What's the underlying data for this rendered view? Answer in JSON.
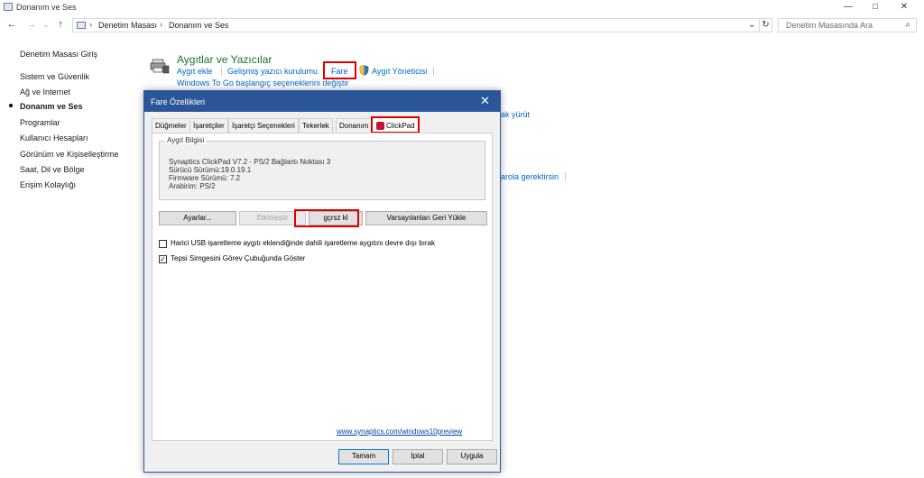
{
  "window": {
    "title": "Donanım ve Ses",
    "min": "—",
    "max": "□",
    "close": "✕"
  },
  "address": {
    "back": "←",
    "forward": "→",
    "recent": "⌄",
    "up": "↑",
    "crumbs": [
      "Denetim Masası",
      "Donanım ve Ses"
    ],
    "sep": "›",
    "dropdown": "⌄",
    "refresh": "↻",
    "search_placeholder": "Denetim Masasında Ara",
    "search_icon": "⌕"
  },
  "sidebar": {
    "items": [
      "Denetim Masası Giriş",
      "Sistem ve Güvenlik",
      "Ağ ve Internet",
      "Donanım ve Ses",
      "Programlar",
      "Kullanıcı Hesapları",
      "Görünüm ve Kişiselleştirme",
      "Saat, Dil ve Bölge",
      "Erişim Kolaylığı"
    ]
  },
  "main": {
    "section_title": "Aygıtlar ve Yazıcılar",
    "links": [
      "Aygıt ekle",
      "Gelişmiş yazıcı kurulumu",
      "Fare",
      "Aygıt Yöneticisi"
    ],
    "link2": "Windows To Go başlangıç seçeneklerini değiştir",
    "partial1": "ak yürüt",
    "partial2": "arola gerektirsin"
  },
  "dialog": {
    "title": "Fare Özellikleri",
    "close": "✕",
    "tabs": [
      "Düğmeler",
      "İşaretçiler",
      "İşaretçi Seçenekleri",
      "Tekerlek",
      "Donanım",
      "ClickPad"
    ],
    "active_tab": "ClickPad",
    "group_label": "Aygıt Bilgisi",
    "info": [
      "Synaptics ClickPad V7.2 - PS/2 Bağlantı Noktası 3",
      "Sürücü Sürümü:19.0.19.1",
      "Firmware Sürümü: 7.2",
      "Arabirim: PS/2"
    ],
    "buttons": {
      "settings": "Ayarlar...",
      "enable": "Etkinleştir",
      "disable": "gçrsz kl",
      "defaults": "Varsayılanları Geri Yükle"
    },
    "checkboxes": [
      {
        "label": "Harici USB işaretleme aygıtı eklendiğinde dahili işaretleme aygıtını devre dışı bırak",
        "checked": false
      },
      {
        "label": "Tepsi Simgesini Görev Çubuğunda Göster",
        "checked": true
      }
    ],
    "check_mark": "✓",
    "url": "www.synaptics.com/windows10preview",
    "footer": {
      "ok": "Tamam",
      "cancel": "İptal",
      "apply": "Uygula"
    }
  }
}
